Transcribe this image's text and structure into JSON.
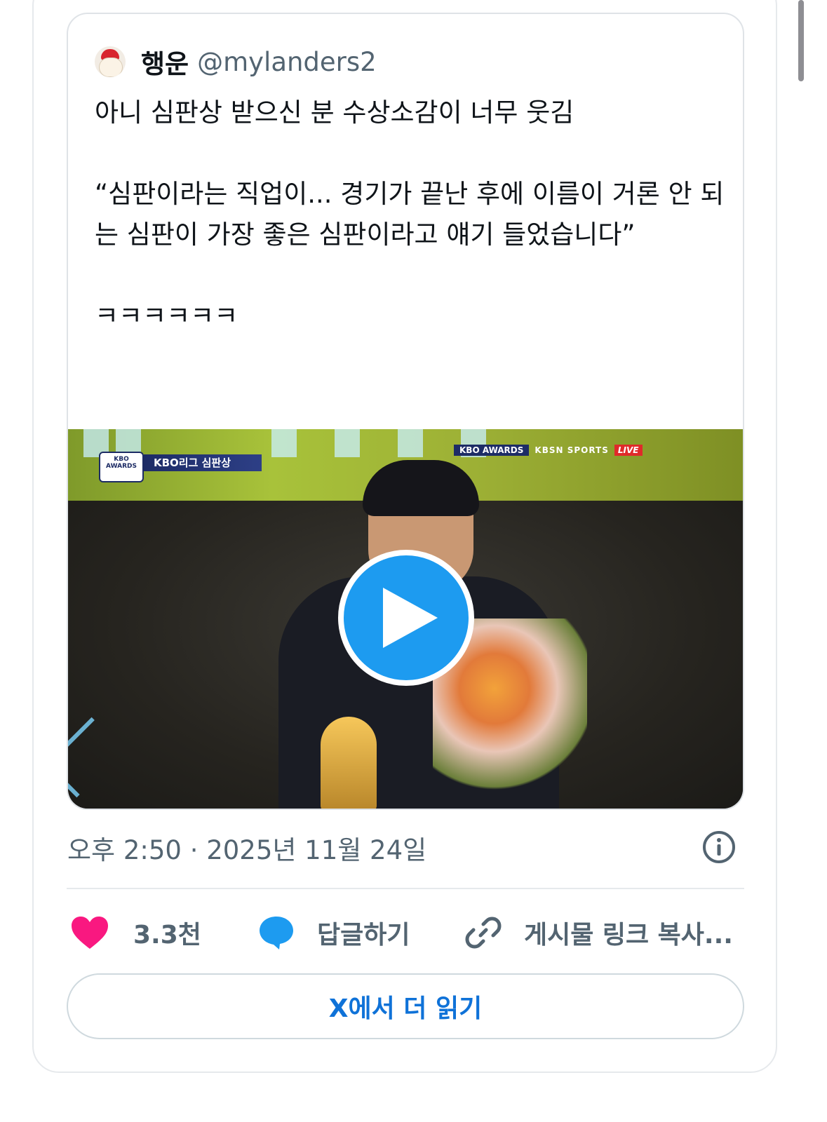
{
  "tweet": {
    "author_name": "행운",
    "author_handle": "@mylanders2",
    "text": "아니 심판상 받으신 분 수상소감이 너무 웃김\n\n“심판이라는 직업이... 경기가 끝난 후에 이름이 거론 안 되는 심판이 가장 좋은 심판이라고 얘기 들었습니다”\n\nㅋㅋㅋㅋㅋㅋ",
    "timestamp": "오후 2:50 · 2025년 11월 24일"
  },
  "media": {
    "lower_third": "KBO리그 심판상",
    "badge": "KBO AWARDS",
    "broadcast_event": "KBO AWARDS",
    "broadcast_network": "KBSN SPORTS",
    "broadcast_live": "LIVE"
  },
  "actions": {
    "like_count": "3.3천",
    "reply_label": "답글하기",
    "copy_link_label": "게시물 링크 복사..."
  },
  "read_more_label": "X에서 더 읽기",
  "colors": {
    "accent": "#1d9bf0",
    "like": "#f91880",
    "secondary_text": "#536471",
    "link": "#0f72d8"
  },
  "icons": [
    "info-icon",
    "heart-icon",
    "reply-bubble-icon",
    "link-icon",
    "play-icon"
  ]
}
